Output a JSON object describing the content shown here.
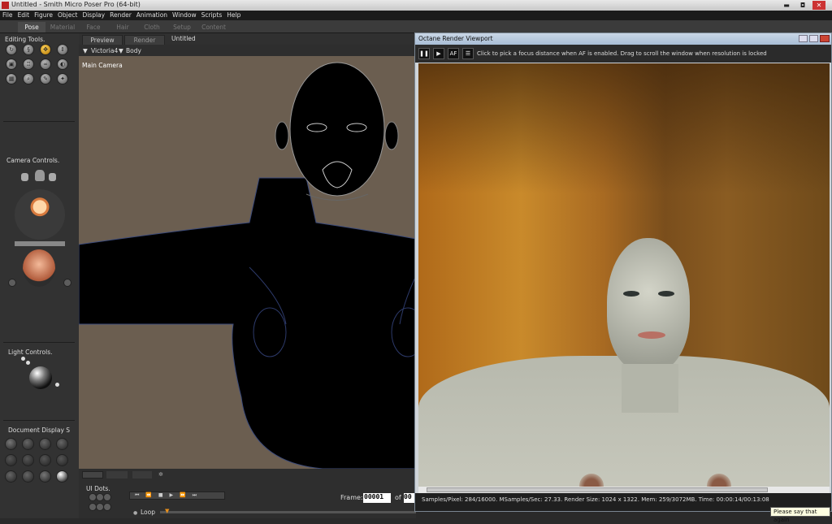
{
  "window": {
    "title": "Untitled - Smith Micro Poser Pro  (64-bit)",
    "minimize": "▬",
    "maximize": "◘",
    "close": "✕"
  },
  "menu": [
    "File",
    "Edit",
    "Figure",
    "Object",
    "Display",
    "Render",
    "Animation",
    "Window",
    "Scripts",
    "Help"
  ],
  "rooms": [
    "Pose",
    "Material",
    "Face",
    "Hair",
    "Cloth",
    "Setup",
    "Content"
  ],
  "left_panel": {
    "editing_tools": "Editing Tools.",
    "camera_controls": "Camera Controls.",
    "light_controls": "Light Controls.",
    "document_display": "Document Display S"
  },
  "doc_tabs": {
    "preview": "Preview",
    "render": "Render",
    "doc_title": "Untitled"
  },
  "viewport": {
    "figure_select": "Victoria4",
    "part_select": "Body",
    "camera_label": "Main Camera"
  },
  "bottom": {
    "ui_dots": "UI Dots.",
    "loop": "Loop",
    "frame_label": "Frame:",
    "frame_value": "00001",
    "of_label": "of",
    "of_value": "00"
  },
  "octane": {
    "title": "Octane Render Viewport",
    "hint": "Click to pick a focus distance when AF is enabled.  Drag to scroll the window when resolution is locked",
    "af": "AF",
    "status": "Samples/Pixel: 284/16000.  MSamples/Sec: 27.33.  Render Size: 1024 x 1322.  Mem: 259/3072MB.  Time: 00:00:14/00:13:08"
  },
  "tooltip": "Please say that again",
  "colors": {
    "viewport_bg": "#6b5e50",
    "panel_bg": "#323232",
    "octane_frame": "#cfd4d9",
    "accent_active": "#ffd35a"
  }
}
